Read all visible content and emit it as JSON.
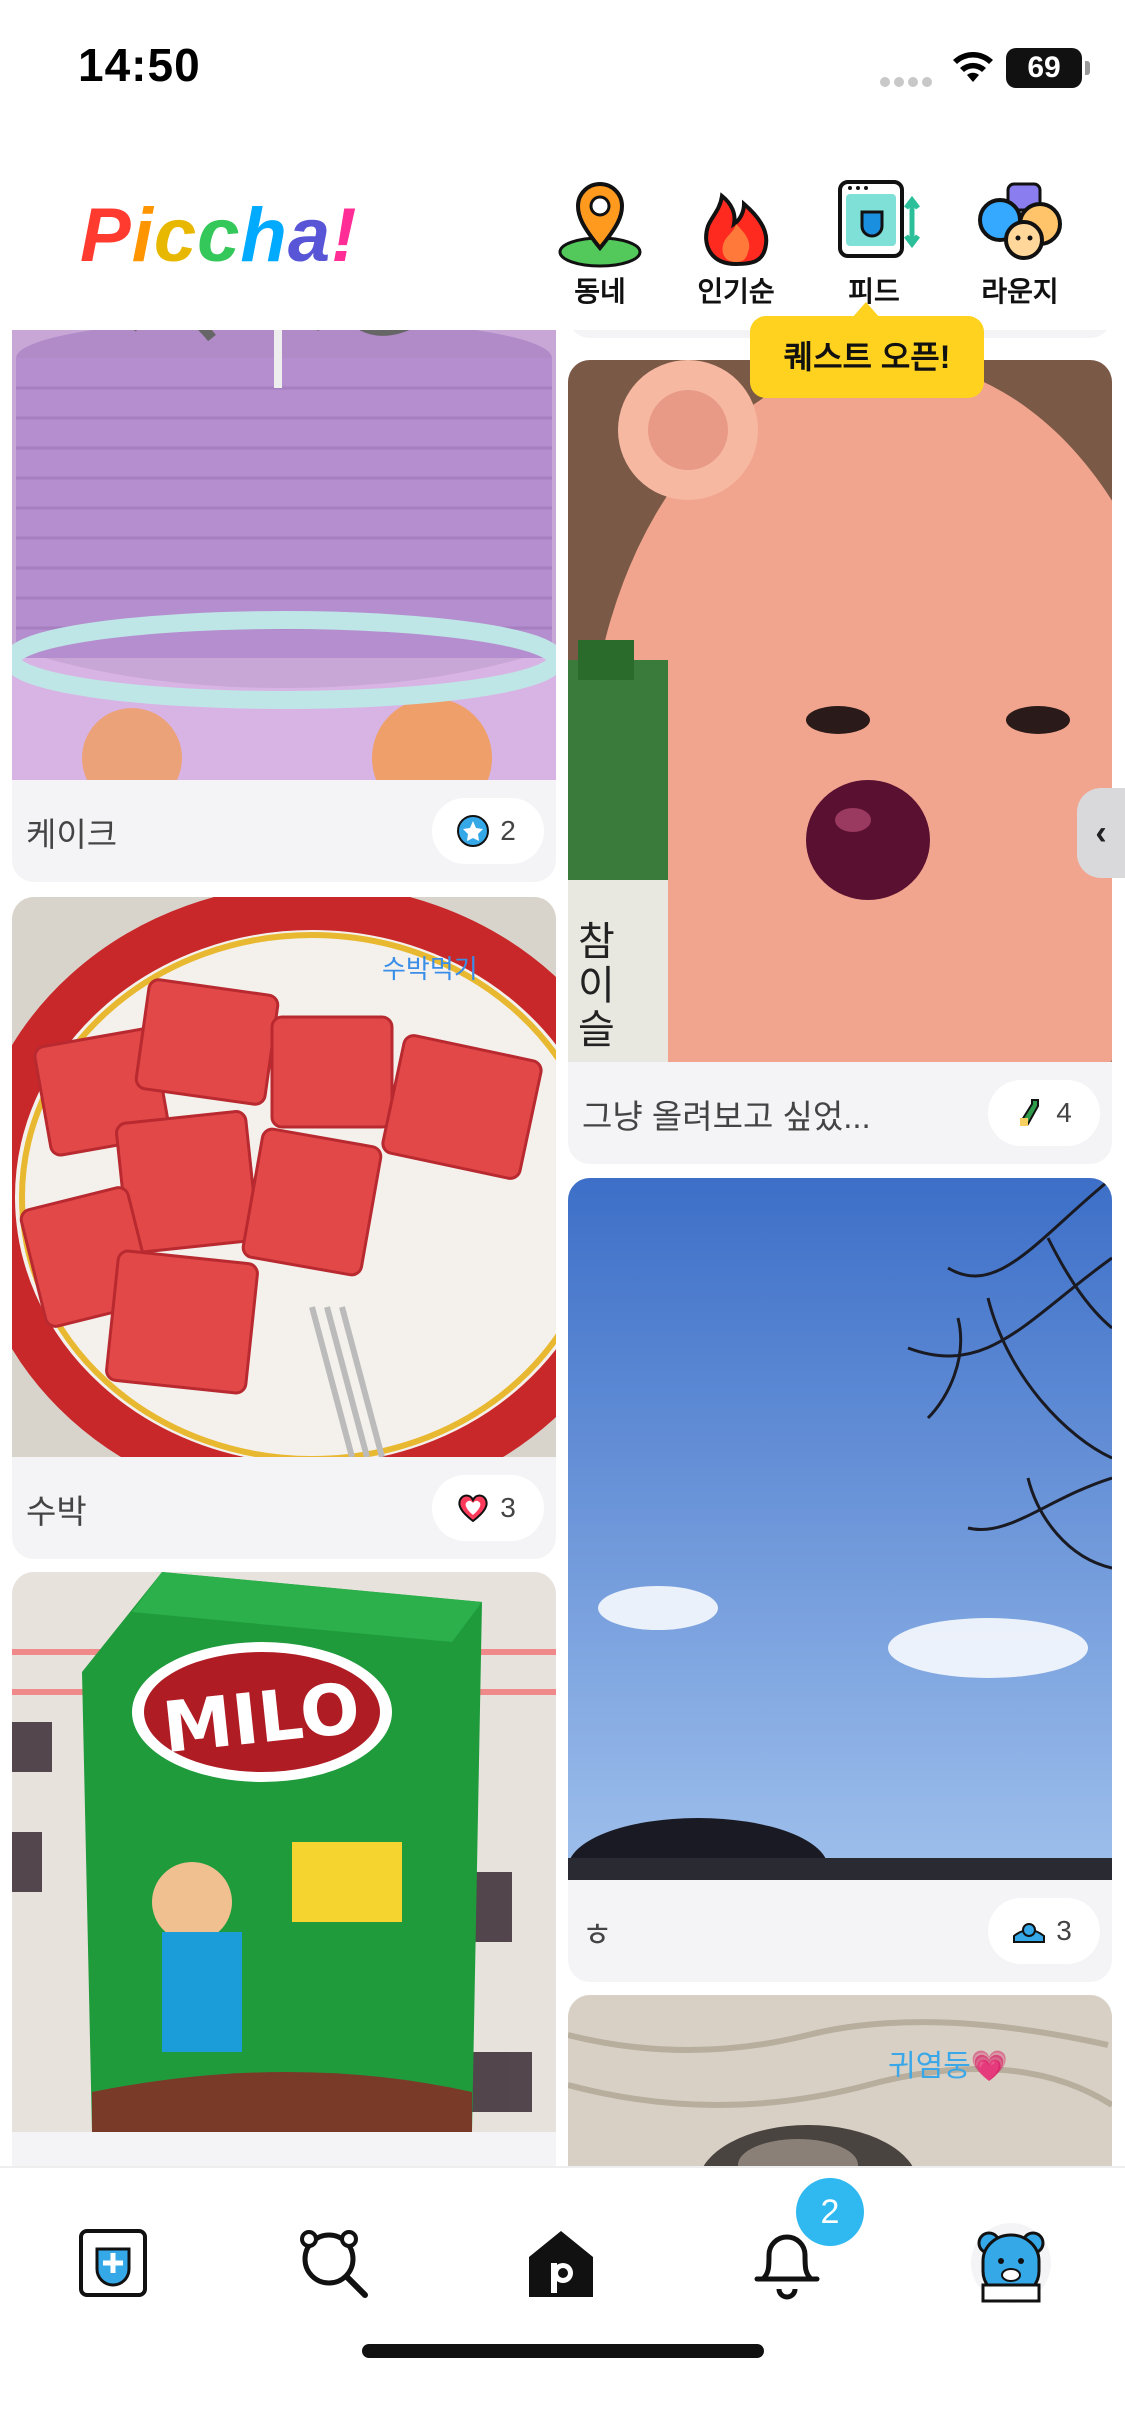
{
  "status": {
    "time": "14:50",
    "battery": "69"
  },
  "header": {
    "logo_letters": [
      "P",
      "i",
      "c",
      "c",
      "h",
      "a",
      "!"
    ],
    "logo_colors": [
      "#ff3b30",
      "#ff9500",
      "#f5c400",
      "#34c759",
      "#00aaff",
      "#5856d6",
      "#ff2d95"
    ],
    "nav": [
      {
        "label": "동네",
        "icon": "map-pin-icon"
      },
      {
        "label": "인기순",
        "icon": "fire-icon"
      },
      {
        "label": "피드",
        "icon": "feed-frame-icon"
      },
      {
        "label": "라운지",
        "icon": "lounge-characters-icon"
      }
    ],
    "tooltip": "퀘스트 오픈!"
  },
  "feed": {
    "left": [
      {
        "caption": "케이크",
        "badge_icon": "star-badge-icon",
        "count": "2"
      },
      {
        "caption": "수박",
        "badge_icon": "heart-icon",
        "count": "3",
        "overlay_text": "수박먹기"
      },
      {
        "caption": "",
        "badge_icon": "",
        "count": ""
      }
    ],
    "right": [
      {
        "caption": "그냥 올려보고 싶었...",
        "badge_icon": "bottle-icon",
        "count": "4",
        "overlay_text": "참 이슬"
      },
      {
        "caption": "ㅎ",
        "badge_icon": "bear-swim-icon",
        "count": "3"
      },
      {
        "caption": "",
        "badge_icon": "",
        "count": "",
        "overlay_text": "귀염둥💗"
      }
    ],
    "side_handle": "‹"
  },
  "bottom_nav": {
    "tabs": [
      "add-post-icon",
      "search-bear-icon",
      "home-p-icon",
      "bell-icon",
      "profile-bear-icon"
    ],
    "notification_count": "2"
  },
  "colors": {
    "accent": "#2fb9f0",
    "tooltip": "#ffd21f",
    "card_bg": "#f4f4f6"
  }
}
